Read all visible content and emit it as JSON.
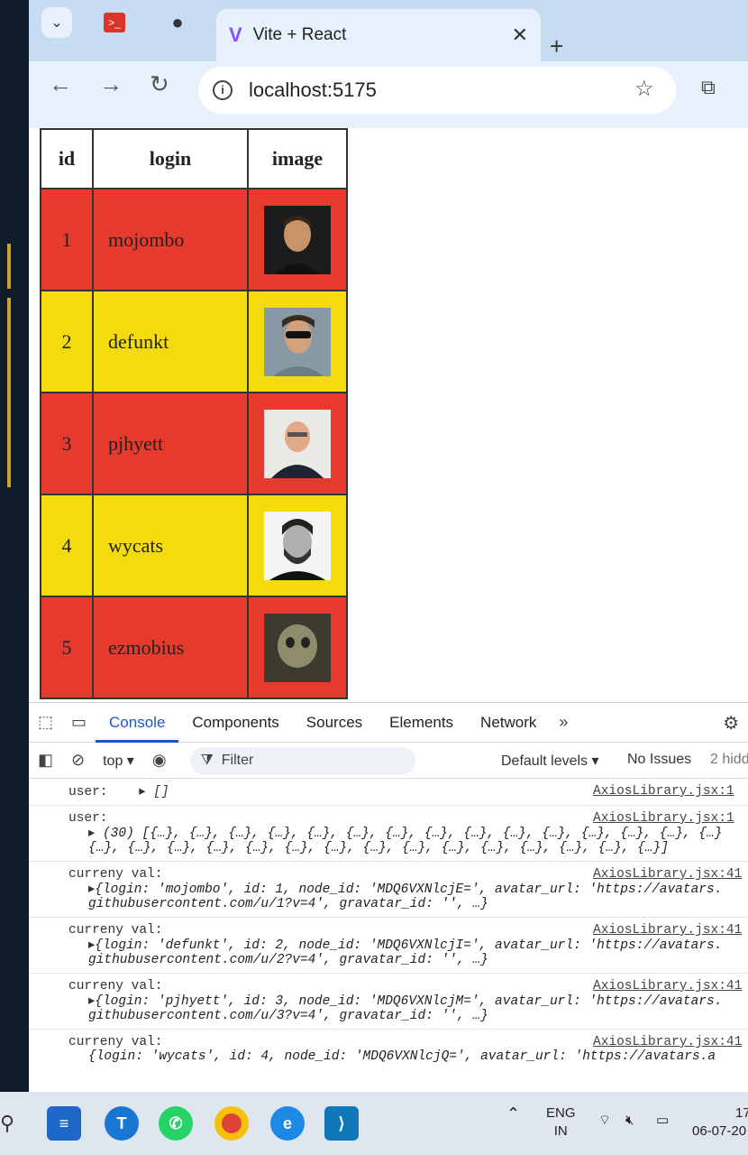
{
  "browser": {
    "tab_title": "Vite + React",
    "url": "localhost:5175"
  },
  "table": {
    "headers": [
      "id",
      "login",
      "image"
    ],
    "rows": [
      {
        "id": "1",
        "login": "mojombo",
        "color": "#e53a2c"
      },
      {
        "id": "2",
        "login": "defunkt",
        "color": "#f4dc0c"
      },
      {
        "id": "3",
        "login": "pjhyett",
        "color": "#e53a2c"
      },
      {
        "id": "4",
        "login": "wycats",
        "color": "#f4dc0c"
      },
      {
        "id": "5",
        "login": "ezmobius",
        "color": "#e53a2c"
      }
    ]
  },
  "devtools": {
    "tabs": [
      "Console",
      "Components",
      "Sources",
      "Elements",
      "Network"
    ],
    "context": "top",
    "filter_placeholder": "Filter",
    "levels": "Default levels",
    "issues": "No Issues",
    "hidden": "2 hidd"
  },
  "console": {
    "entries": [
      {
        "label": "user:",
        "inline": "[]",
        "source": "AxiosLibrary.jsx:1"
      },
      {
        "label": "user:",
        "line1": "(30) [{…}, {…}, {…}, {…}, {…}, {…}, {…}, {…}, {…}, {…}, {…}, {…}, {…}, {…}, {…}",
        "line2": "{…}, {…}, {…}, {…}, {…}, {…}, {…}, {…}, {…}, {…}, {…}, {…}, {…}, {…}, {…}]",
        "source": "AxiosLibrary.jsx:1"
      },
      {
        "label": "curreny val:",
        "line1": "{login: 'mojombo', id: 1, node_id: 'MDQ6VXNlcjE=', avatar_url: 'https://avatars.",
        "line2": "githubusercontent.com/u/1?v=4', gravatar_id: '', …}",
        "source": "AxiosLibrary.jsx:41"
      },
      {
        "label": "curreny val:",
        "line1": "{login: 'defunkt', id: 2, node_id: 'MDQ6VXNlcjI=', avatar_url: 'https://avatars.",
        "line2": "githubusercontent.com/u/2?v=4', gravatar_id: '', …}",
        "source": "AxiosLibrary.jsx:41"
      },
      {
        "label": "curreny val:",
        "line1": "{login: 'pjhyett', id: 3, node_id: 'MDQ6VXNlcjM=', avatar_url: 'https://avatars.",
        "line2": "githubusercontent.com/u/3?v=4', gravatar_id: '', …}",
        "source": "AxiosLibrary.jsx:41"
      },
      {
        "label": "curreny val:",
        "line1": "{login: 'wycats', id: 4, node_id: 'MDQ6VXNlcjQ=', avatar_url: 'https://avatars.a",
        "line2": "",
        "source": "AxiosLibrary.jsx:41"
      }
    ]
  },
  "taskbar": {
    "lang_top": "ENG",
    "lang_bottom": "IN",
    "time": "17",
    "date": "06-07-20"
  }
}
